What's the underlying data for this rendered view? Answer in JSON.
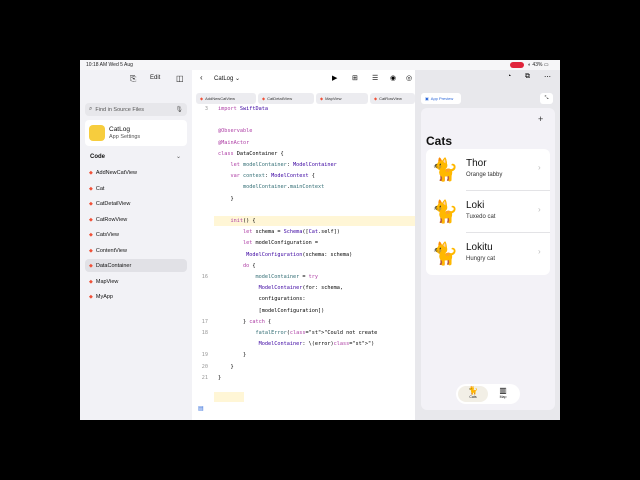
{
  "status": {
    "time": "10:18 AM",
    "date": "Wed 5 Aug",
    "battery": "43%"
  },
  "sidebar": {
    "edit_label": "Edit",
    "search_placeholder": "Find in Source Files",
    "project": {
      "name": "CatLog",
      "subtitle": "App Settings"
    },
    "section_title": "Code",
    "files": [
      "AddNewCatView",
      "Cat",
      "CatDetailView",
      "CatRowView",
      "CatsView",
      "ContentView",
      "DataContainer",
      "MapView",
      "MyApp"
    ],
    "selected_file": "DataContainer"
  },
  "editor": {
    "project_title": "CatLog",
    "tabs": [
      "AddNewCatView",
      "CatDetailView",
      "MapView",
      "CatRowView"
    ],
    "code_lines": [
      {
        "n": "3",
        "t": "import SwiftData"
      },
      {
        "n": "",
        "t": ""
      },
      {
        "n": "",
        "t": "@Observable"
      },
      {
        "n": "",
        "t": "@MainActor"
      },
      {
        "n": "",
        "t": "class DataContainer {"
      },
      {
        "n": "",
        "t": "    let modelContainer: ModelContainer"
      },
      {
        "n": "",
        "t": "    var context: ModelContext {"
      },
      {
        "n": "",
        "t": "        modelContainer.mainContext"
      },
      {
        "n": "",
        "t": "    }"
      },
      {
        "n": "",
        "t": ""
      },
      {
        "n": "",
        "t": "    init() {"
      },
      {
        "n": "",
        "t": "        let schema = Schema([Cat.self])"
      },
      {
        "n": "",
        "t": "        let modelConfiguration ="
      },
      {
        "n": "",
        "t": "         ModelConfiguration(schema: schema)"
      },
      {
        "n": "",
        "t": "        do {"
      },
      {
        "n": "16",
        "t": "            modelContainer = try"
      },
      {
        "n": "",
        "t": "             ModelContainer(for: schema,"
      },
      {
        "n": "",
        "t": "             configurations:"
      },
      {
        "n": "",
        "t": "             [modelConfiguration])"
      },
      {
        "n": "17",
        "t": "        } catch {"
      },
      {
        "n": "18",
        "t": "            fatalError(\"Could not create"
      },
      {
        "n": "",
        "t": "             ModelContainer: \\(error)\")"
      },
      {
        "n": "19",
        "t": "        }"
      },
      {
        "n": "20",
        "t": "    }"
      },
      {
        "n": "21",
        "t": "}"
      }
    ]
  },
  "preview": {
    "button_label": "App Preview",
    "title": "Cats",
    "cats": [
      {
        "name": "Thor",
        "subtitle": "Orange tabby"
      },
      {
        "name": "Loki",
        "subtitle": "Tuxedo cat"
      },
      {
        "name": "Lokitu",
        "subtitle": "Hungry cat"
      }
    ],
    "tabbar": [
      {
        "label": "Cats",
        "icon": "cat-icon"
      },
      {
        "label": "Map",
        "icon": "map-icon"
      }
    ]
  },
  "colors": {
    "accent": "#2a66d9",
    "swift": "#f05138",
    "record": "#e0243b",
    "app_icon": "#f7cd3d"
  }
}
